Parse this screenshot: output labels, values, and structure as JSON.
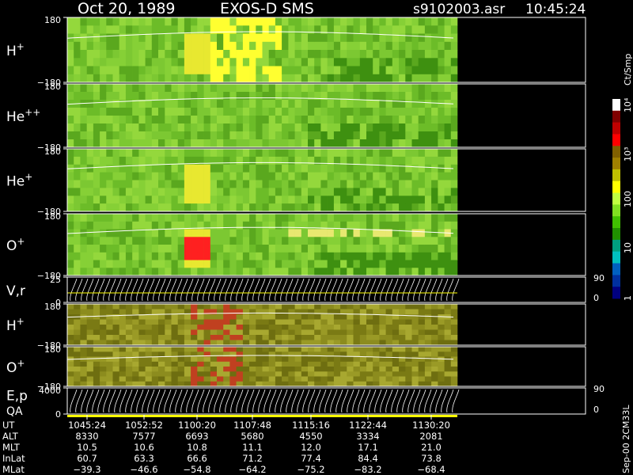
{
  "header": {
    "date": "Oct 20, 1989",
    "instrument": "EXOS-D SMS",
    "file": "s9102003.asr",
    "time": "10:45:24"
  },
  "chart_data": {
    "type": "heatmap",
    "panels": [
      {
        "label": "H",
        "sup": "+",
        "ytop": "180",
        "ybot": "−180",
        "style": "color"
      },
      {
        "label": "He",
        "sup": "++",
        "ytop": "180",
        "ybot": "−180",
        "style": "color"
      },
      {
        "label": "He",
        "sup": "+",
        "ytop": "180",
        "ybot": "−180",
        "style": "color"
      },
      {
        "label": "O",
        "sup": "+",
        "ytop": "180",
        "ybot": "−180",
        "style": "color"
      },
      {
        "label": "V,r",
        "sup": "",
        "ytop": "25",
        "ybot": "0",
        "rtop": "90",
        "rbot": "0",
        "style": "lines"
      },
      {
        "label": "H",
        "sup": "+",
        "ytop": "180",
        "ybot": "−180",
        "style": "olive"
      },
      {
        "label": "O",
        "sup": "+",
        "ytop": "180",
        "ybot": "−180",
        "style": "olive"
      },
      {
        "label": "E,p",
        "label2": "QA",
        "sup": "",
        "ytop": "4000",
        "ybot": "0",
        "rtop": "90",
        "rbot": "0",
        "style": "lines"
      }
    ],
    "colorbar": {
      "label": "Ct/Smp",
      "ticks": [
        "10⁴",
        "10³",
        "100",
        "10",
        "1"
      ],
      "colors": [
        "#ffffff",
        "#800000",
        "#c00000",
        "#ff0000",
        "#806000",
        "#a08000",
        "#c0c000",
        "#ffff00",
        "#c0ff40",
        "#80e020",
        "#40c000",
        "#209000",
        "#00a080",
        "#00c0c0",
        "#0060c0",
        "#0030a0",
        "#000080"
      ]
    },
    "x_axis": {
      "rows": [
        {
          "name": "UT",
          "values": [
            "1045:24",
            "1052:52",
            "1100:20",
            "1107:48",
            "1115:16",
            "1122:44",
            "1130:20"
          ]
        },
        {
          "name": "ALT",
          "values": [
            "8330",
            "7577",
            "6693",
            "5680",
            "4550",
            "3334",
            "2081"
          ]
        },
        {
          "name": "MLT",
          "values": [
            "10.5",
            "10.6",
            "10.8",
            "11.1",
            "12.0",
            "17.1",
            "21.0"
          ]
        },
        {
          "name": "InLat",
          "values": [
            "60.7",
            "63.3",
            "66.6",
            "71.2",
            "77.4",
            "84.4",
            "73.8"
          ]
        },
        {
          "name": "MLat",
          "values": [
            "−39.3",
            "−46.6",
            "−54.8",
            "−64.2",
            "−75.2",
            "−83.2",
            "−68.4"
          ]
        }
      ]
    },
    "footer_note": "Sep-00 2CM33L"
  }
}
